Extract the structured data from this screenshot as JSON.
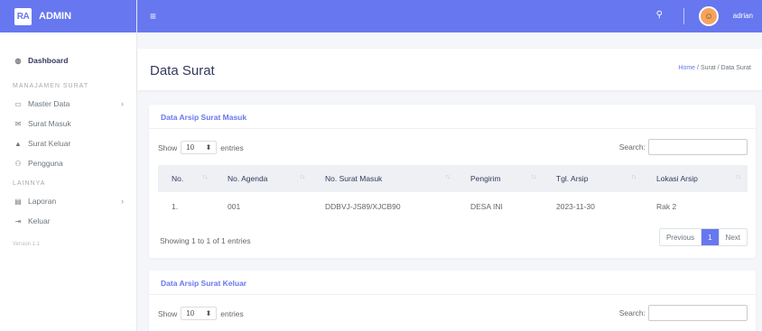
{
  "brand": {
    "logo": "RA",
    "name": "ADMIN"
  },
  "sidebar": {
    "items": [
      {
        "label": "Dashboard",
        "icon": "dashboard-icon"
      },
      {
        "header": "MANAJAMEN SURAT"
      },
      {
        "label": "Master Data",
        "icon": "folder-icon"
      },
      {
        "label": "Surat Masuk",
        "icon": "envelope-icon"
      },
      {
        "label": "Surat Keluar",
        "icon": "outbox-icon"
      },
      {
        "label": "Pengguna",
        "icon": "users-icon"
      },
      {
        "header": "LAINNYA"
      },
      {
        "label": "Laporan",
        "icon": "report-icon"
      },
      {
        "label": "Keluar",
        "icon": "logout-icon"
      }
    ],
    "version": "Version 1.1"
  },
  "topbar": {
    "user": "adrian"
  },
  "page": {
    "title": "Data Surat",
    "breadcrumb": {
      "home": "Home",
      "sep": "/",
      "level1": "Surat",
      "current": "Data Surat"
    }
  },
  "card_masuk": {
    "title": "Data Arsip Surat Masuk",
    "show_label": "Show",
    "entries_value": "10",
    "entries_label": "entries",
    "search_label": "Search:",
    "columns": [
      "No.",
      "No. Agenda",
      "No. Surat Masuk",
      "Pengirim",
      "Tgl. Arsip",
      "Lokasi Arsip"
    ],
    "rows": [
      [
        "1.",
        "001",
        "DDBVJ-JS89/XJCB90",
        "DESA INI",
        "2023-11-30",
        "Rak 2"
      ]
    ],
    "info": "Showing 1 to 1 of 1 entries",
    "pagination": {
      "prev": "Previous",
      "page": "1",
      "next": "Next"
    }
  },
  "card_keluar": {
    "title": "Data Arsip Surat Keluar",
    "show_label": "Show",
    "entries_value": "10",
    "entries_label": "entries",
    "search_label": "Search:"
  },
  "colors": {
    "primary": "#6777ef",
    "background": "#f4f6f9"
  }
}
